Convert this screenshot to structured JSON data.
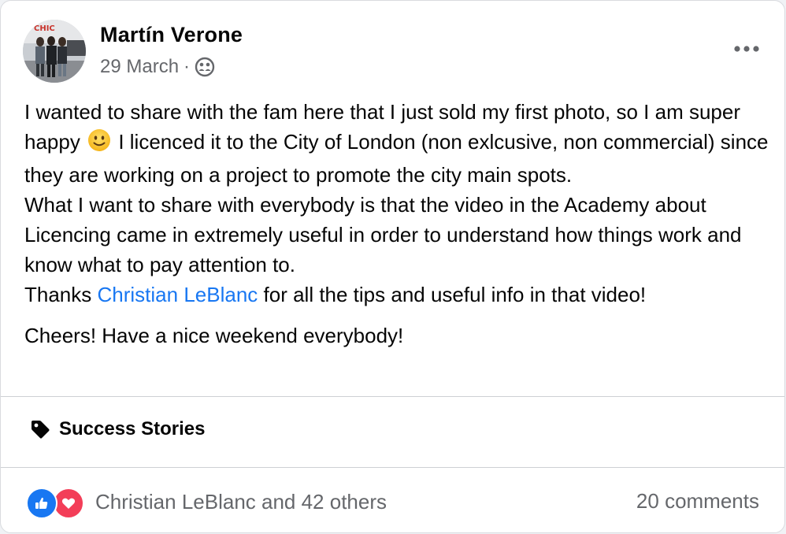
{
  "post": {
    "author": "Martín Verone",
    "date": "29 March",
    "separator": "·",
    "privacy_icon": "group-icon",
    "more_icon": "more-options-icon",
    "paragraph1_line_a": "I wanted to share with the fam here that I just sold my first photo, so I am super happy",
    "emoji": "slightly-smiling-face-emoji",
    "paragraph1_line_b": "I licenced it to the City of London (non exlcusive, non commercial) since they are working on a project to promote the city main spots.",
    "paragraph1_line_c": "What I want to share with everybody is that the video in the Academy about Licencing came in extremely useful in order to understand how things work and know what to pay attention to.",
    "paragraph1_thanks_prefix": "Thanks",
    "mention": "Christian LeBlanc",
    "paragraph1_thanks_suffix": "for all the tips and useful info in that video!",
    "paragraph2": "Cheers! Have a nice weekend everybody!",
    "topic_icon": "tag-icon",
    "topic": "Success Stories",
    "reactions_text": "Christian LeBlanc and 42 others",
    "reaction_icons": [
      "like-icon",
      "love-icon"
    ],
    "comments": "20 comments"
  },
  "colors": {
    "link": "#1877f2",
    "secondary_text": "#65676b",
    "like": "#1877f2",
    "love": "#f33e58"
  }
}
